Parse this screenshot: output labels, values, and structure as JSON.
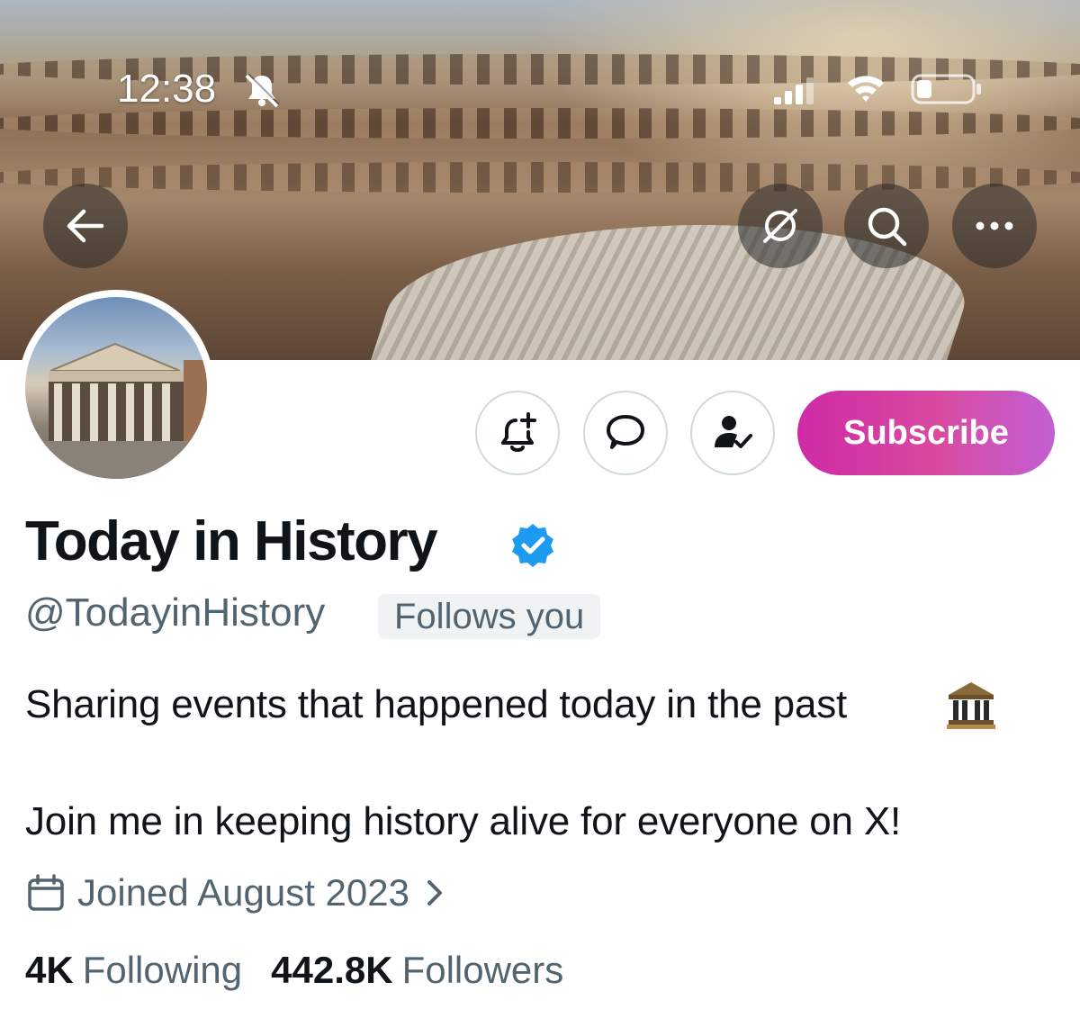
{
  "status_bar": {
    "time": "12:38",
    "icons": [
      "bell-slash-icon",
      "cellular-signal-icon",
      "wifi-icon",
      "battery-icon"
    ]
  },
  "header": {
    "buttons": [
      "back-arrow-icon",
      "grok-icon",
      "search-icon",
      "more-icon"
    ]
  },
  "profile": {
    "display_name": "Today in History",
    "verified": true,
    "handle": "@TodayinHistory",
    "follows_you": "Follows you",
    "bio_line_1": "Sharing events that happened today in the past",
    "bio_line_2": "Join me in keeping history alive for everyone on X!",
    "joined": "Joined August 2023",
    "following_count": "4K",
    "following_label": "Following",
    "followers_count": "442.8K",
    "followers_label": "Followers"
  },
  "actions": {
    "subscribe_label": "Subscribe",
    "icons": [
      "notification-bell-plus-icon",
      "message-bubble-icon",
      "user-check-icon"
    ]
  },
  "colors": {
    "verified_blue": "#1d9bf0",
    "subscribe_gradient_start": "#cf2aa6",
    "subscribe_gradient_end": "#c25fd4",
    "secondary_text": "#536471"
  }
}
